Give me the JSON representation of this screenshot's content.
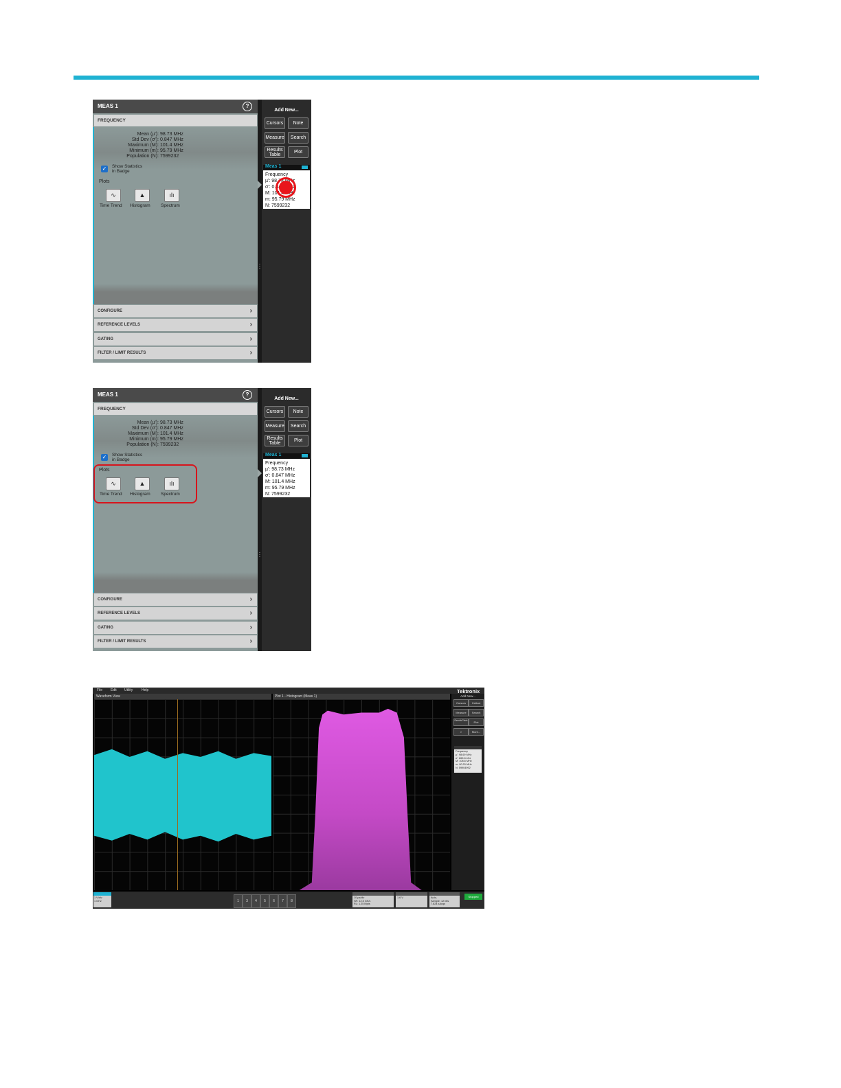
{
  "panel": {
    "title": "MEAS 1",
    "help_icon": "?",
    "section": "FREQUENCY",
    "stats": {
      "mean_label": "Mean (µ'):",
      "mean_value": "98.73 MHz",
      "std_label": "Std Dev (σ'):",
      "std_value": "0.847 MHz",
      "max_label": "Maximum (M):",
      "max_value": "101.4 MHz",
      "min_label": "Minimum (m):",
      "min_value": "95.79 MHz",
      "pop_label": "Population (N):",
      "pop_value": "7599232"
    },
    "show_stats_line1": "Show Statistics",
    "show_stats_line2": "in Badge",
    "plots_label": "Plots",
    "plot_buttons": [
      "Time Trend",
      "Histogram",
      "Spectrum"
    ],
    "sections": [
      "CONFIGURE",
      "REFERENCE LEVELS",
      "GATING",
      "FILTER / LIMIT RESULTS"
    ]
  },
  "sidebar": {
    "add_new": "Add New...",
    "buttons": [
      "Cursors",
      "Note",
      "Measure",
      "Search",
      "Plot"
    ],
    "results_line1": "Results",
    "results_line2": "Table",
    "badge": {
      "name": "Meas 1",
      "lines": [
        "Frequency",
        "µ': 98.73 MHz",
        "σ': 0.847 MHz",
        "M: 101.4 MHz",
        "m: 95.79 MHz",
        "N: 7599232"
      ]
    }
  },
  "scope": {
    "menu": [
      "File",
      "Edit",
      "Utility",
      "Help"
    ],
    "logo": "Tektronix",
    "waveform_title": "Waveform View",
    "histogram_title": "Plot 1 - Histogram (Meas 1)",
    "add_new": "Add New...",
    "side_buttons": [
      "Cursors",
      "Callout",
      "Measure",
      "Search",
      "Results Table",
      "Plot",
      "",
      "More..."
    ],
    "badge_lines": [
      "Frequency",
      "µ': 98.69 MHz",
      "σ': 865.6 kHz",
      "M: 108.6 MHz",
      "m: 90.20 MHz",
      "N: 59904992"
    ],
    "ch1_lines": [
      "1 V/div",
      "1 GHz"
    ],
    "channel_buttons": [
      "1",
      "3",
      "4",
      "5",
      "6",
      "7",
      "8"
    ],
    "horizontal_lines": [
      "10 µs/div",
      "SR: 12.5 GS/s",
      "RL: 1.25 Mpts"
    ],
    "trigger_lines": [
      "1.6 V"
    ],
    "acquisition_lines": [
      "Auto,",
      "Sample: 12 bits",
      "7.824 kAcqs"
    ],
    "stopped": "Stopped",
    "accent": "#1fb2d2",
    "histogram_color": "#e15be5",
    "waveform_color": "#20c4cc"
  },
  "colors": {
    "rule": "#1fb2d2",
    "callout": "#e8151b"
  }
}
